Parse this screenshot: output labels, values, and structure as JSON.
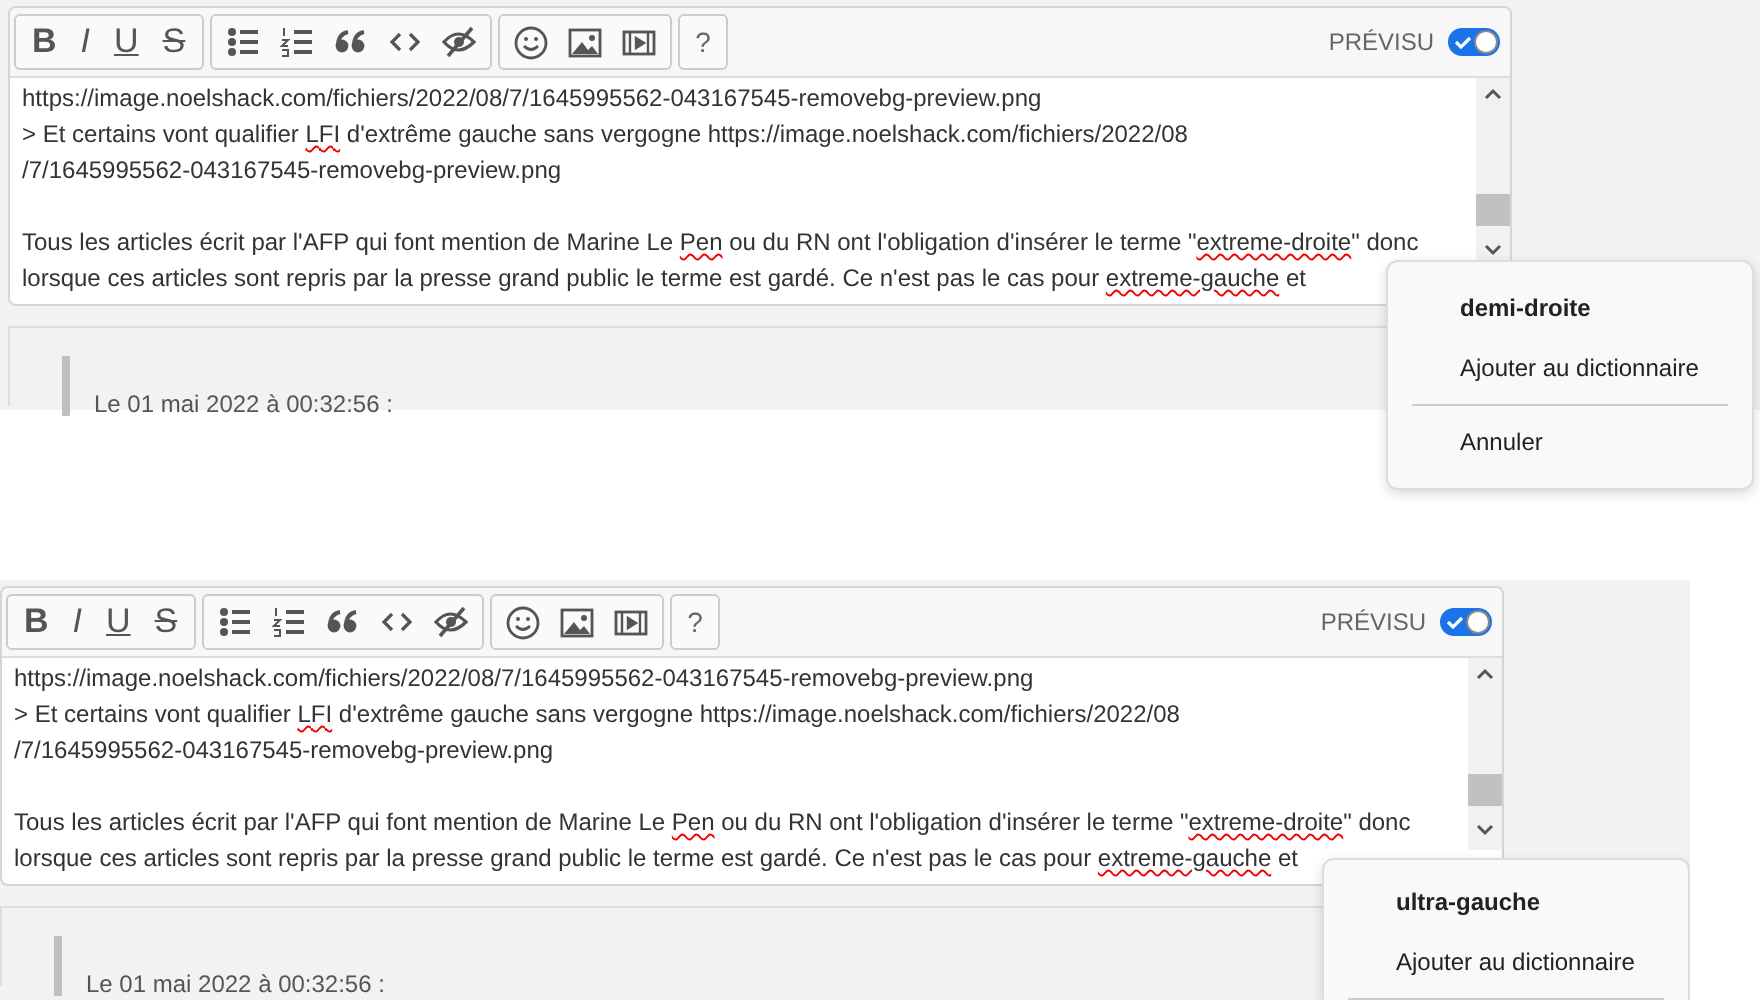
{
  "panels": [
    {
      "toolbar": {
        "groups": [
          [
            {
              "kind": "bold",
              "label": "B"
            },
            {
              "kind": "italic",
              "label": "I"
            },
            {
              "kind": "underline",
              "label": "U"
            },
            {
              "kind": "strike",
              "label": "S"
            }
          ],
          [
            {
              "kind": "bullets"
            },
            {
              "kind": "numbers"
            },
            {
              "kind": "quote"
            },
            {
              "kind": "code"
            },
            {
              "kind": "spoiler"
            }
          ],
          [
            {
              "kind": "emoji"
            },
            {
              "kind": "image"
            },
            {
              "kind": "video"
            }
          ],
          [
            {
              "kind": "help",
              "label": "?"
            }
          ]
        ],
        "preview": {
          "label": "PRÉVISU",
          "on": true
        }
      },
      "paragraphs": [
        [
          [
            {
              "text": "https://image.noelshack.com/fichiers/2022/08/7/1645995562-043167545-removebg-preview.png",
              "misspelled": false
            }
          ],
          [
            {
              "text": "> Et certains vont qualifier ",
              "misspelled": false
            },
            {
              "text": "LFI",
              "misspelled": true
            },
            {
              "text": " d'extrême gauche sans vergogne https://image.noelshack.com/fichiers/2022/08",
              "misspelled": false
            }
          ],
          [
            {
              "text": "/7/1645995562-043167545-removebg-preview.png",
              "misspelled": false
            }
          ]
        ],
        [
          [
            {
              "text": "Tous les articles écrit par l'AFP qui font mention de Marine Le ",
              "misspelled": false
            },
            {
              "text": "Pen",
              "misspelled": true
            },
            {
              "text": " ou du RN ont l'obligation d'insérer le terme \"",
              "misspelled": false
            },
            {
              "text": "extreme-droite",
              "misspelled": true
            },
            {
              "text": "\" donc",
              "misspelled": false
            }
          ],
          [
            {
              "text": "lorsque ces articles sont repris par la presse grand public le terme est gardé. Ce n'est pas le cas pour ",
              "misspelled": false
            },
            {
              "text": "extreme-gauche",
              "misspelled": true
            },
            {
              "text": " et",
              "misspelled": false
            }
          ]
        ]
      ],
      "quote_date": "Le 01 mai 2022 à 00:32:56 :",
      "context_menu": [
        {
          "kind": "suggestion",
          "label": "demi-droite"
        },
        {
          "kind": "action",
          "label": "Ajouter au dictionnaire"
        },
        {
          "kind": "divider"
        },
        {
          "kind": "action",
          "label": "Annuler"
        }
      ]
    },
    {
      "toolbar": {
        "groups": [
          [
            {
              "kind": "bold",
              "label": "B"
            },
            {
              "kind": "italic",
              "label": "I"
            },
            {
              "kind": "underline",
              "label": "U"
            },
            {
              "kind": "strike",
              "label": "S"
            }
          ],
          [
            {
              "kind": "bullets"
            },
            {
              "kind": "numbers"
            },
            {
              "kind": "quote"
            },
            {
              "kind": "code"
            },
            {
              "kind": "spoiler"
            }
          ],
          [
            {
              "kind": "emoji"
            },
            {
              "kind": "image"
            },
            {
              "kind": "video"
            }
          ],
          [
            {
              "kind": "help",
              "label": "?"
            }
          ]
        ],
        "preview": {
          "label": "PRÉVISU",
          "on": true
        }
      },
      "paragraphs": [
        [
          [
            {
              "text": "https://image.noelshack.com/fichiers/2022/08/7/1645995562-043167545-removebg-preview.png",
              "misspelled": false
            }
          ],
          [
            {
              "text": "> Et certains vont qualifier ",
              "misspelled": false
            },
            {
              "text": "LFI",
              "misspelled": true
            },
            {
              "text": " d'extrême gauche sans vergogne https://image.noelshack.com/fichiers/2022/08",
              "misspelled": false
            }
          ],
          [
            {
              "text": "/7/1645995562-043167545-removebg-preview.png",
              "misspelled": false
            }
          ]
        ],
        [
          [
            {
              "text": "Tous les articles écrit par l'AFP qui font mention de Marine Le ",
              "misspelled": false
            },
            {
              "text": "Pen",
              "misspelled": true
            },
            {
              "text": " ou du RN ont l'obligation d'insérer le terme \"",
              "misspelled": false
            },
            {
              "text": "extreme-droite",
              "misspelled": true
            },
            {
              "text": "\" donc",
              "misspelled": false
            }
          ],
          [
            {
              "text": "lorsque ces articles sont repris par la presse grand public le terme est gardé. Ce n'est pas le cas pour ",
              "misspelled": false
            },
            {
              "text": "extreme-gauche",
              "misspelled": true
            },
            {
              "text": " et",
              "misspelled": false
            }
          ]
        ]
      ],
      "quote_date": "Le 01 mai 2022 à 00:32:56 :",
      "context_menu": [
        {
          "kind": "suggestion",
          "label": "ultra-gauche"
        },
        {
          "kind": "action",
          "label": "Ajouter au dictionnaire"
        },
        {
          "kind": "divider"
        }
      ]
    }
  ]
}
